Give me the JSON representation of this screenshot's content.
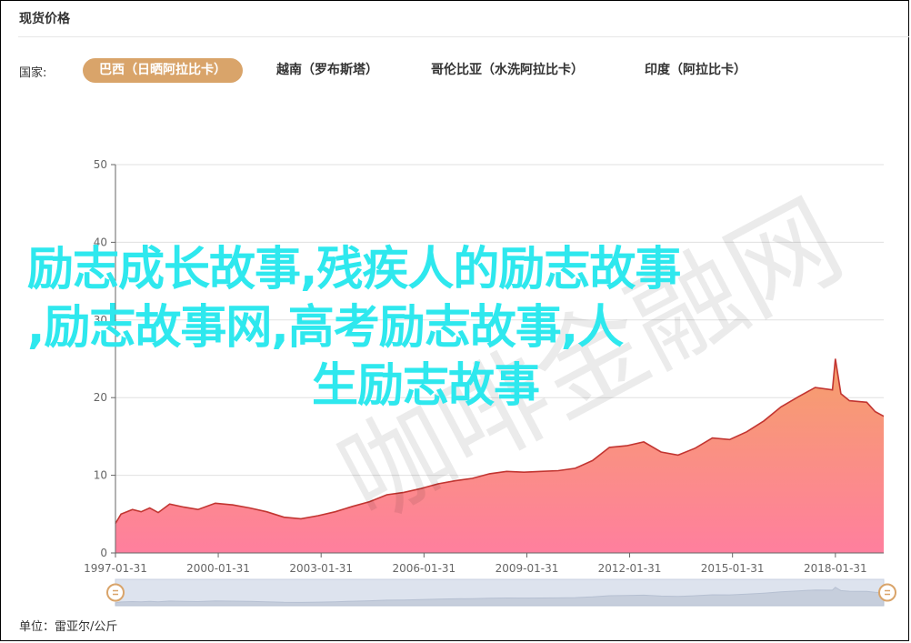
{
  "header": {
    "title": "现货价格"
  },
  "filter": {
    "label": "国家:",
    "tabs": [
      {
        "label": "巴西（日晒阿拉比卡）",
        "active": true
      },
      {
        "label": "越南（罗布斯塔）",
        "active": false
      },
      {
        "label": "哥伦比亚（水洗阿拉比卡）",
        "active": false
      },
      {
        "label": "印度（阿拉比卡）",
        "active": false
      }
    ]
  },
  "footer": {
    "unit": "单位：雷亚尔/公斤"
  },
  "overlay": {
    "line1": "励志成长故事,残疾人的励志故事",
    "line2": ",励志故事网,高考励志故事,人",
    "line3": "生励志故事"
  },
  "watermark": "咖啡金融网",
  "colors": {
    "accent": "#d9a46a",
    "line": "#c23531",
    "area_top": "#f5a06a",
    "area_bottom": "#ff7f9e",
    "overlay_text": "#2ee8ee"
  },
  "chart_data": {
    "type": "area",
    "xlabel": "",
    "ylabel": "",
    "ylim": [
      0,
      50
    ],
    "yticks": [
      0,
      10,
      20,
      30,
      40,
      50
    ],
    "xlim": [
      "1997-01-31",
      "2019-06-30"
    ],
    "xticks": [
      "1997-01-31",
      "2000-01-31",
      "2003-01-31",
      "2006-01-31",
      "2009-01-31",
      "2012-01-31",
      "2015-01-31",
      "2018-01-31"
    ],
    "grid": true,
    "series": [
      {
        "points": [
          [
            "1997-01-31",
            3.8
          ],
          [
            "1997-03-31",
            5.0
          ],
          [
            "1997-07-31",
            5.6
          ],
          [
            "1997-10-31",
            5.3
          ],
          [
            "1998-01-31",
            5.8
          ],
          [
            "1998-04-31",
            5.2
          ],
          [
            "1998-08-31",
            6.3
          ],
          [
            "1999-01-31",
            5.9
          ],
          [
            "1999-06-30",
            5.6
          ],
          [
            "1999-12-31",
            6.4
          ],
          [
            "2000-06-30",
            6.2
          ],
          [
            "2000-12-31",
            5.8
          ],
          [
            "2001-06-30",
            5.3
          ],
          [
            "2001-12-31",
            4.6
          ],
          [
            "2002-06-30",
            4.4
          ],
          [
            "2002-12-31",
            4.8
          ],
          [
            "2003-06-30",
            5.3
          ],
          [
            "2003-12-31",
            6.0
          ],
          [
            "2004-06-30",
            6.6
          ],
          [
            "2004-12-31",
            7.5
          ],
          [
            "2005-06-30",
            7.8
          ],
          [
            "2005-12-31",
            8.3
          ],
          [
            "2006-06-30",
            8.9
          ],
          [
            "2006-12-31",
            9.3
          ],
          [
            "2007-06-30",
            9.6
          ],
          [
            "2007-12-31",
            10.2
          ],
          [
            "2008-06-30",
            10.5
          ],
          [
            "2008-12-31",
            10.4
          ],
          [
            "2009-06-30",
            10.5
          ],
          [
            "2009-12-31",
            10.6
          ],
          [
            "2010-06-30",
            10.9
          ],
          [
            "2010-12-31",
            11.9
          ],
          [
            "2011-06-30",
            13.6
          ],
          [
            "2011-12-31",
            13.8
          ],
          [
            "2012-06-30",
            14.3
          ],
          [
            "2012-12-31",
            13.0
          ],
          [
            "2013-06-30",
            12.6
          ],
          [
            "2013-12-31",
            13.5
          ],
          [
            "2014-06-30",
            14.8
          ],
          [
            "2014-12-31",
            14.6
          ],
          [
            "2015-06-30",
            15.6
          ],
          [
            "2015-12-31",
            17.0
          ],
          [
            "2016-06-30",
            18.8
          ],
          [
            "2016-12-31",
            20.1
          ],
          [
            "2017-06-30",
            21.3
          ],
          [
            "2017-12-31",
            21.0
          ],
          [
            "2018-01-31",
            25.0
          ],
          [
            "2018-03-31",
            20.5
          ],
          [
            "2018-06-30",
            19.6
          ],
          [
            "2018-12-31",
            19.4
          ],
          [
            "2019-03-31",
            18.2
          ],
          [
            "2019-06-30",
            17.6
          ]
        ]
      }
    ]
  }
}
